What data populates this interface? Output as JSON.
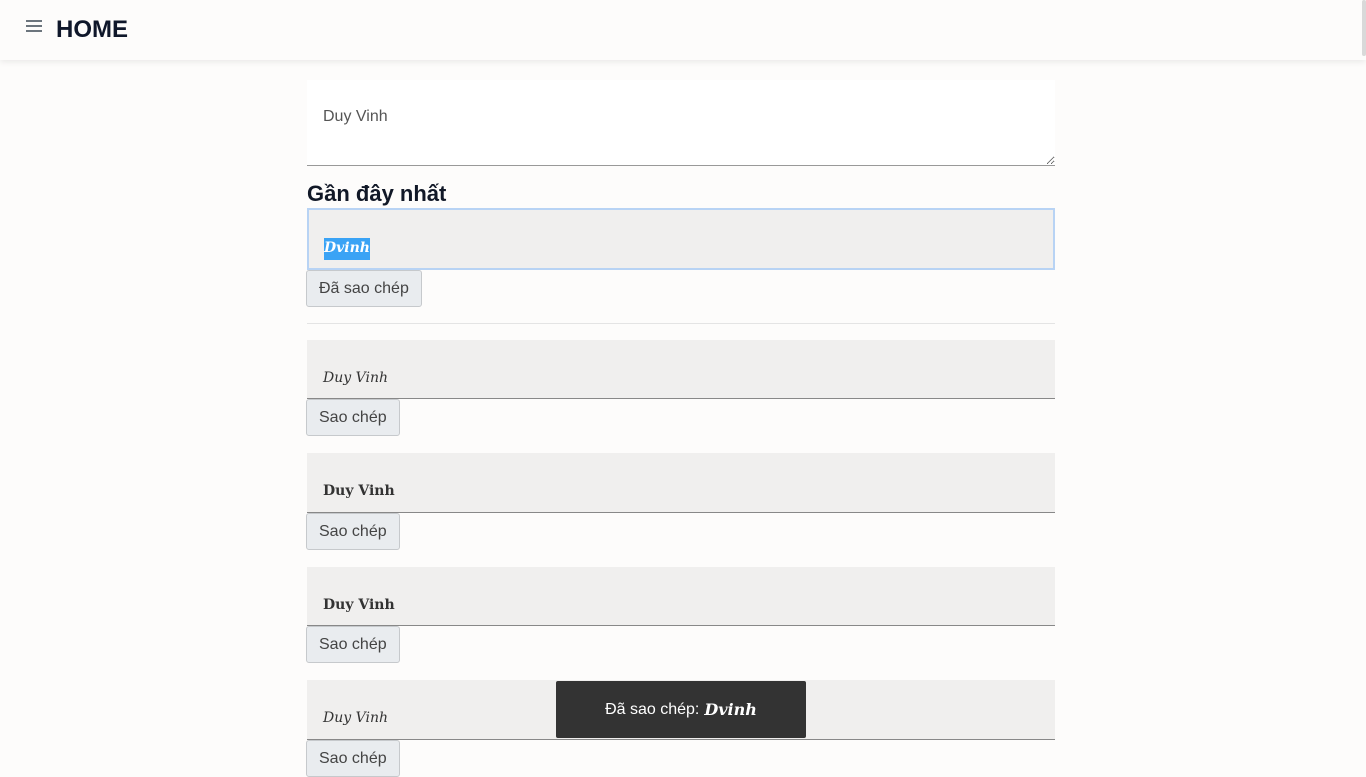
{
  "navbar": {
    "menu_icon": "hamburger-menu-icon",
    "brand": "HOME"
  },
  "input": {
    "value": "Duy Vinh"
  },
  "section_title": "Gần đây nhất",
  "results": [
    {
      "text": "Dvinh",
      "style": "bold-italic-serif",
      "selected": true,
      "button_label": "Đã sao chép"
    },
    {
      "text": "Duy Vinh",
      "style": "italic-serif",
      "button_label": "Sao chép"
    },
    {
      "text": "Duy Vinh",
      "style": "bold-serif",
      "button_label": "Sao chép"
    },
    {
      "text": "Duy Vinh",
      "style": "bold-serif",
      "button_label": "Sao chép"
    },
    {
      "text": "Duy Vinh",
      "style": "italic-serif",
      "button_label": "Sao chép"
    }
  ],
  "toast": {
    "label": "Đã sao chép:",
    "value": "Dvinh"
  },
  "colors": {
    "background": "#fdfcfb",
    "result_background": "#f0efee",
    "selection_highlight": "#3aa3f5",
    "toast_background": "#333333",
    "focus_border": "#b8d3f4"
  }
}
